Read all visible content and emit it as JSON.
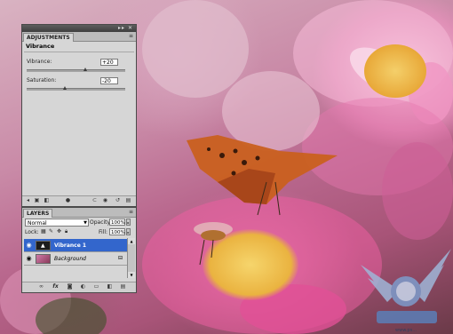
{
  "adjustments_panel": {
    "tab_label": "ADJUSTMENTS",
    "header": "Vibrance",
    "vibrance": {
      "label": "Vibrance:",
      "value": "+20",
      "level": 0.6
    },
    "saturation": {
      "label": "Saturation:",
      "value": "-20",
      "level": 0.4
    },
    "bottom_icons": [
      "back-arrow-icon",
      "expand-icon",
      "new-layer-icon",
      "eye-icon",
      "visibility-icon",
      "clip-icon",
      "reset-icon",
      "trash-icon"
    ]
  },
  "layers_panel": {
    "tab_label": "LAYERS",
    "blend_mode": "Normal",
    "opacity_label": "Opacity:",
    "opacity_value": "100%",
    "lock_label": "Lock:",
    "fill_label": "Fill:",
    "fill_value": "100%",
    "layers": [
      {
        "name": "Vibrance 1",
        "selected": true
      },
      {
        "name": "Background",
        "selected": false
      }
    ],
    "bottom_icons": [
      "link-icon",
      "fx-icon",
      "mask-icon",
      "adjustment-icon",
      "group-icon",
      "new-layer-icon",
      "trash-icon"
    ]
  },
  "watermark": {
    "text": "www.ps..."
  },
  "colors": {
    "selection": "#3366cc",
    "panel_bg": "#d6d6d6",
    "titlebar": "#4a4a4a",
    "butterfly": "#c9601f",
    "flower_center": "#f2c34a"
  }
}
